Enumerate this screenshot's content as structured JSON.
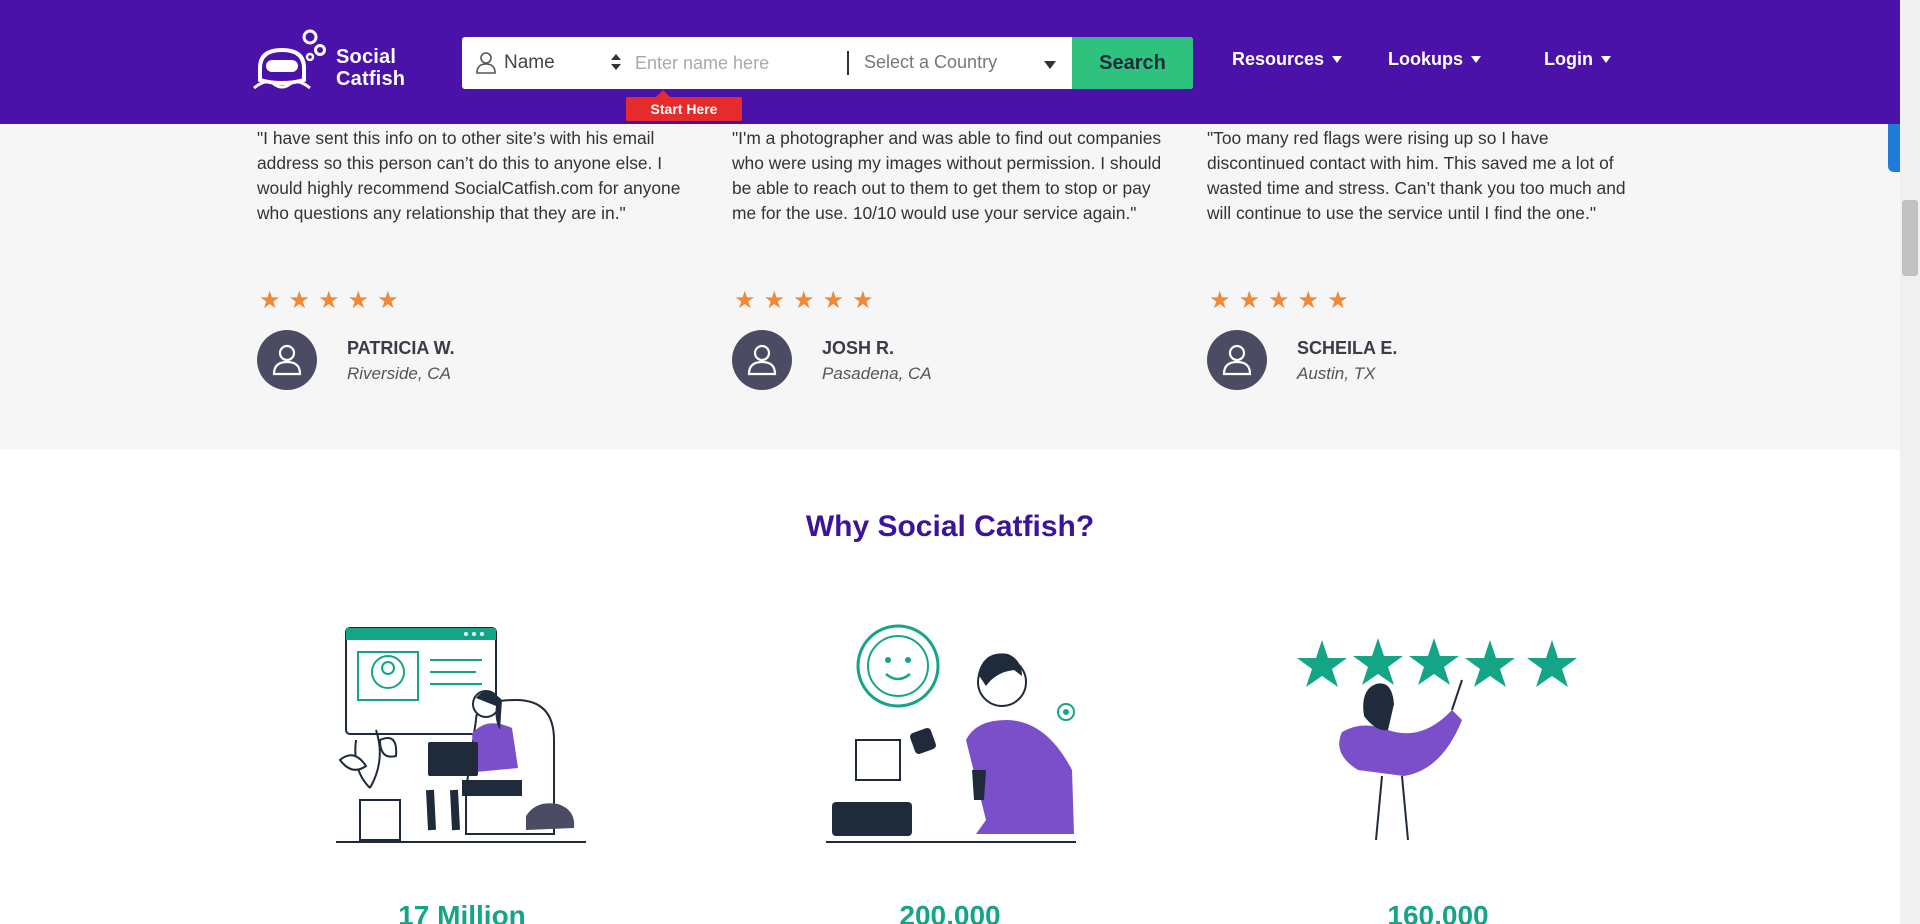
{
  "header": {
    "logo_line1": "Social",
    "logo_line2": "Catfish",
    "search_type": "Name",
    "name_placeholder": "Enter name here",
    "country_label": "Select a Country",
    "search_button": "Search",
    "start_here": "Start Here",
    "nav": [
      {
        "label": "Resources"
      },
      {
        "label": "Lookups"
      },
      {
        "label": "Login"
      }
    ]
  },
  "testimonials": [
    {
      "quote": "\"I have sent this info on to other site’s with his email address so this person can’t do this to anyone else. I would highly recommend SocialCatfish.com for anyone who questions any relationship that they are in.\"",
      "rating": 5,
      "name": "PATRICIA W.",
      "location": "Riverside, CA"
    },
    {
      "quote": "\"I'm a photographer and was able to find out companies who were using my images without permission. I should be able to reach out to them to get them to stop or pay me for the use. 10/10 would use your service again.\"",
      "rating": 5,
      "name": "JOSH R.",
      "location": "Pasadena, CA"
    },
    {
      "quote": "\"Too many red flags were rising up so I have discontinued contact with him. This saved me a lot of wasted time and stress. Can’t thank you too much and will continue to use the service until I find the one.\"",
      "rating": 5,
      "name": "SCHEILA E.",
      "location": "Austin, TX"
    }
  ],
  "why": {
    "title": "Why Social Catfish?",
    "stats": [
      "17 Million",
      "200,000",
      "160,000"
    ]
  },
  "colors": {
    "header_bg": "#4a12a8",
    "search_green": "#2ec27e",
    "start_here_red": "#e52b2b",
    "star_orange": "#f0883a",
    "teal": "#14a587",
    "purple_title": "#3c149a"
  }
}
